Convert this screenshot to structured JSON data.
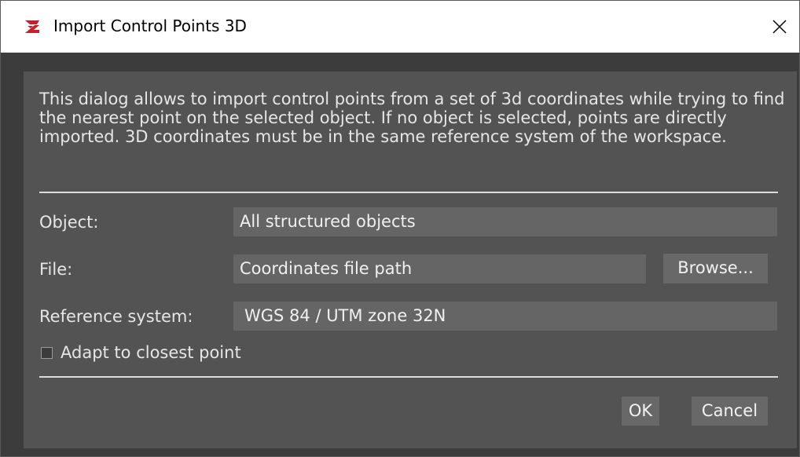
{
  "window": {
    "title": "Import Control Points 3D",
    "app_icon": "red-logo-icon",
    "close_icon": "close-icon"
  },
  "dialog": {
    "description": "This dialog allows to import control points from a set of 3d coordinates while trying to find the nearest point on the selected object. If no object is selected, points are directly imported. 3D coordinates must be in the same reference system of the workspace.",
    "object_label": "Object:",
    "object_value": "All structured objects",
    "file_label": "File:",
    "file_placeholder": "Coordinates file path",
    "browse_label": "Browse...",
    "reference_label": "Reference system:",
    "reference_value": "WGS 84 / UTM zone 32N",
    "adapt_label": "Adapt to closest point",
    "adapt_checked": false,
    "ok_label": "OK",
    "cancel_label": "Cancel"
  },
  "colors": {
    "accent": "#c8202a",
    "panel": "#535353",
    "field": "#656565"
  }
}
